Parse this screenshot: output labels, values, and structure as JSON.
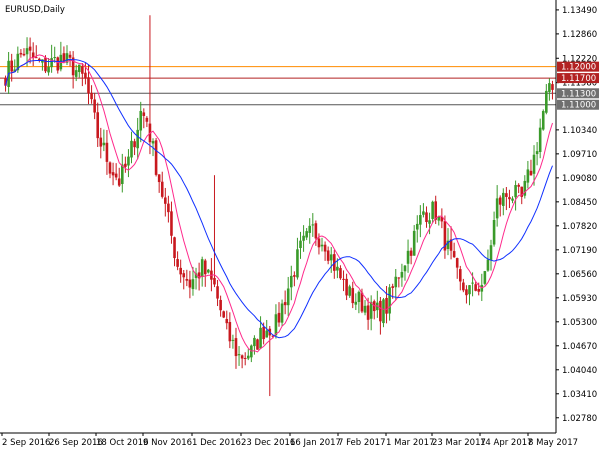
{
  "window_title": "EURUSD,Daily",
  "chart_data": {
    "type": "candlestick",
    "title": "EURUSD,Daily",
    "grid": false,
    "y_ticks": [
      "1.13490",
      "1.12860",
      "1.12220",
      "1.11580",
      "1.10340",
      "1.09710",
      "1.09080",
      "1.08450",
      "1.07820",
      "1.07190",
      "1.06560",
      "1.05930",
      "1.05300",
      "1.04670",
      "1.04040",
      "1.03410",
      "1.02780"
    ],
    "x_ticks": [
      "2 Sep 2016",
      "26 Sep 2016",
      "18 Oct 2016",
      "9 Nov 2016",
      "1 Dec 2016",
      "23 Dec 2016",
      "16 Jan 2017",
      "7 Feb 2017",
      "1 Mar 2017",
      "23 Mar 2017",
      "14 Apr 2017",
      "8 May 2017"
    ],
    "ylim": [
      1.0238,
      1.1375
    ],
    "horizontal_levels": [
      {
        "value": 1.12,
        "label": "1.12000",
        "color": "#ff8c00",
        "label_bg": "#b22222"
      },
      {
        "value": 1.117,
        "label": "1.11700",
        "color": "#b22222",
        "label_bg": "#b22222"
      },
      {
        "value": 1.113,
        "label": "1.11300",
        "color": "#555555",
        "label_bg": "#6f6f6f"
      },
      {
        "value": 1.11,
        "label": "1.11000",
        "color": "#555555",
        "label_bg": "#6f6f6f"
      }
    ],
    "up_color": "#3a9a2a",
    "down_color": "#c8181e",
    "ma_fast_color": "#ff2a8c",
    "ma_slow_color": "#1030ff",
    "anchors": [
      [
        0,
        1.118
      ],
      [
        6,
        1.124
      ],
      [
        12,
        1.12
      ],
      [
        18,
        1.122
      ],
      [
        22,
        1.12
      ],
      [
        26,
        1.116
      ],
      [
        30,
        1.102
      ],
      [
        34,
        1.094
      ],
      [
        37,
        1.09
      ],
      [
        40,
        1.095
      ],
      [
        44,
        1.108
      ],
      [
        46,
        1.106
      ],
      [
        48,
        1.098
      ],
      [
        52,
        1.083
      ],
      [
        56,
        1.068
      ],
      [
        60,
        1.063
      ],
      [
        64,
        1.067
      ],
      [
        68,
        1.062
      ],
      [
        72,
        1.05
      ],
      [
        76,
        1.044
      ],
      [
        80,
        1.045
      ],
      [
        84,
        1.051
      ],
      [
        88,
        1.052
      ],
      [
        92,
        1.062
      ],
      [
        96,
        1.072
      ],
      [
        100,
        1.077
      ],
      [
        104,
        1.074
      ],
      [
        108,
        1.066
      ],
      [
        112,
        1.06
      ],
      [
        116,
        1.058
      ],
      [
        120,
        1.055
      ],
      [
        124,
        1.057
      ],
      [
        128,
        1.066
      ],
      [
        132,
        1.073
      ],
      [
        136,
        1.082
      ],
      [
        140,
        1.082
      ],
      [
        144,
        1.072
      ],
      [
        148,
        1.062
      ],
      [
        152,
        1.061
      ],
      [
        156,
        1.064
      ],
      [
        160,
        1.084
      ],
      [
        164,
        1.087
      ],
      [
        168,
        1.085
      ],
      [
        172,
        1.096
      ],
      [
        174,
        1.104
      ],
      [
        176,
        1.112
      ],
      [
        178,
        1.114
      ]
    ]
  }
}
